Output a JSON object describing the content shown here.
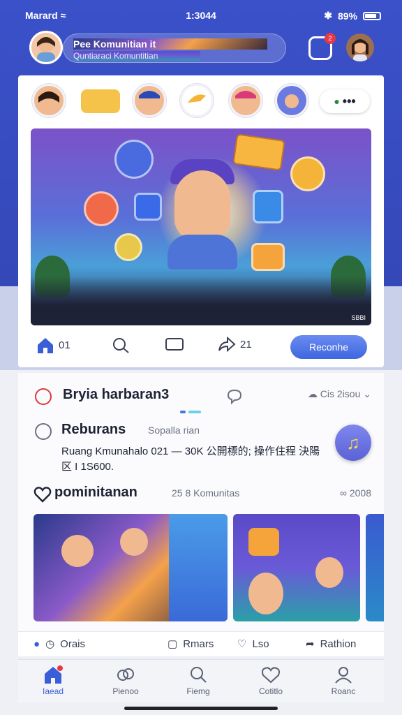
{
  "status_bar": {
    "carrier": "Marard",
    "time": "1:3044",
    "battery": "89%"
  },
  "header": {
    "title": "Pee Komunitian it",
    "subtitle": "Quntiaraci Komuntitian",
    "notification_count": "2"
  },
  "stories": {
    "more_label": "•••"
  },
  "hero": {
    "watermark": "SBBI"
  },
  "post_actions": {
    "like_count": "01",
    "share_count": "21",
    "cta_label": "Reconhe"
  },
  "feed": {
    "section_title": "Bryia harbaran3",
    "section_meta": "Cis 2isou",
    "post_name": "Reburans",
    "post_sub": "Sopalla rian",
    "post_body": "Ruang Kmunahalo 021 — 30K 公開標的; 操作住程 決陽区 I 1S600.",
    "community_title": "pominitanan",
    "community_sub": "25 8 Komunitas",
    "community_meta": "2008"
  },
  "action_bar": {
    "item1": "Orais",
    "item2": "Rmars",
    "item3": "Lso",
    "item4": "Rathion"
  },
  "tabs": [
    {
      "label": "Iaead"
    },
    {
      "label": "Pienoo"
    },
    {
      "label": "Fiemg"
    },
    {
      "label": "Cotitlo"
    },
    {
      "label": "Roanc"
    }
  ],
  "colors": {
    "brand": "#3b51c9",
    "accent": "#3f66e0",
    "badge": "#e53946"
  }
}
